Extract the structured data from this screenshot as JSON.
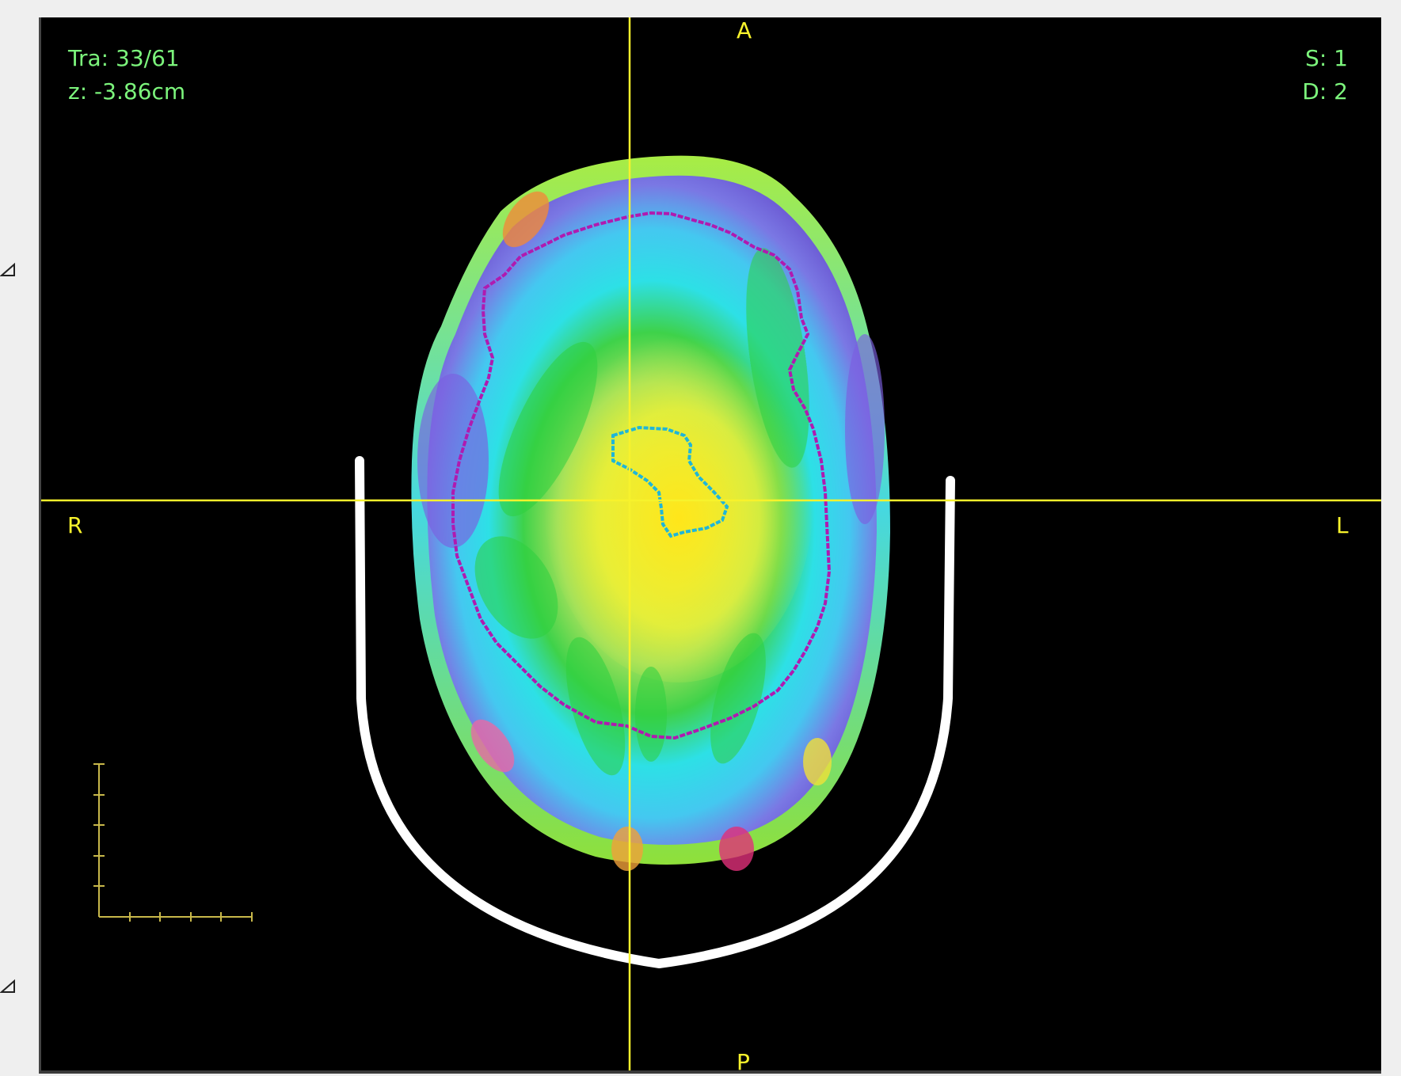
{
  "viewer": {
    "plane_label": "Tra",
    "slice": "33/61",
    "z_label": "z",
    "z_value": "-3.86cm",
    "s_label": "S",
    "s_value": "1",
    "d_label": "D",
    "d_value": "2"
  },
  "orientation": {
    "anterior": "A",
    "posterior": "P",
    "right": "R",
    "left": "L"
  },
  "colors": {
    "crosshair": "#f7f22c",
    "overlay_text": "#7cf57c",
    "contour_body": "#b01ab0",
    "contour_target": "#1fb6d8",
    "couch": "#ffffff"
  },
  "icons": {
    "handle_top": "triangle-handle-icon",
    "handle_bottom": "triangle-handle-icon"
  }
}
